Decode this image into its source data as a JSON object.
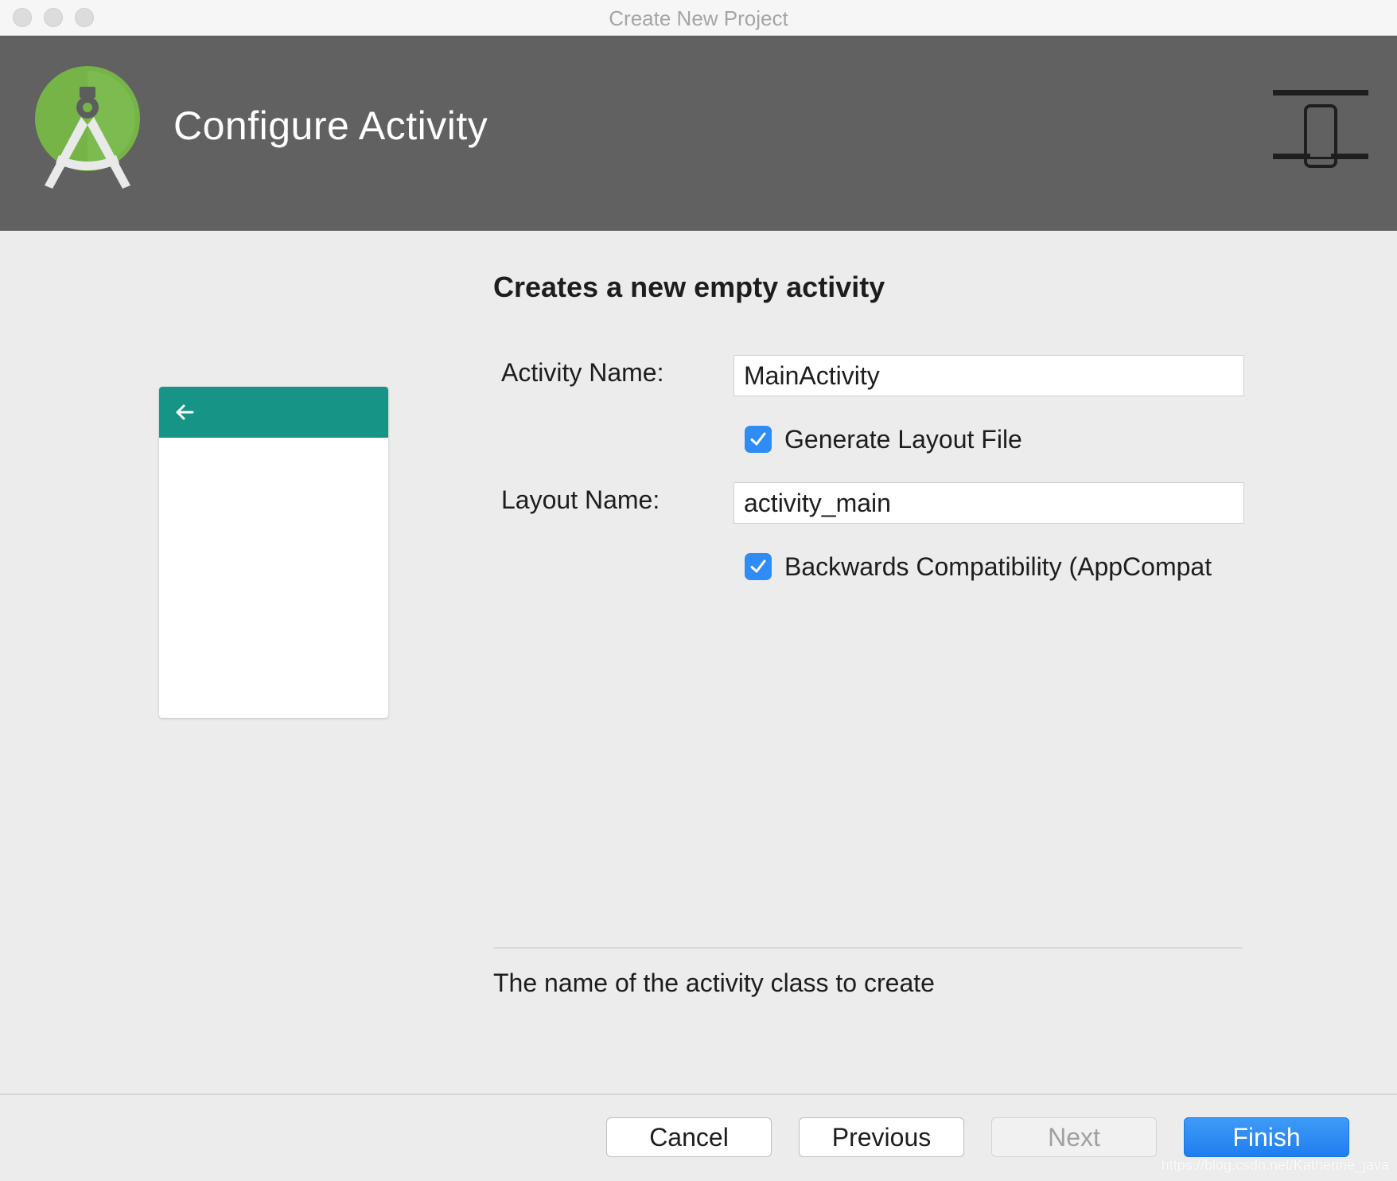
{
  "window": {
    "title": "Create New Project"
  },
  "header": {
    "title": "Configure Activity",
    "logo_icon": "android-studio-logo-icon",
    "device_icon": "phone-device-icon"
  },
  "preview": {
    "back_icon": "arrow-left-icon",
    "appbar_color": "#169587"
  },
  "form": {
    "section_title": "Creates a new empty activity",
    "activity_name_label": "Activity Name:",
    "activity_name_value": "MainActivity",
    "generate_layout_label": "Generate Layout File",
    "generate_layout_checked": true,
    "layout_name_label": "Layout Name:",
    "layout_name_value": "activity_main",
    "backwards_compat_label": "Backwards Compatibility (AppCompat",
    "backwards_compat_checked": true,
    "hint": "The name of the activity class to create",
    "checkbox_color": "#2f8cf5"
  },
  "footer": {
    "cancel_label": "Cancel",
    "previous_label": "Previous",
    "next_label": "Next",
    "finish_label": "Finish",
    "watermark": "https://blog.csdn.net/Katherine_java",
    "primary_color": "#2a86f2"
  }
}
